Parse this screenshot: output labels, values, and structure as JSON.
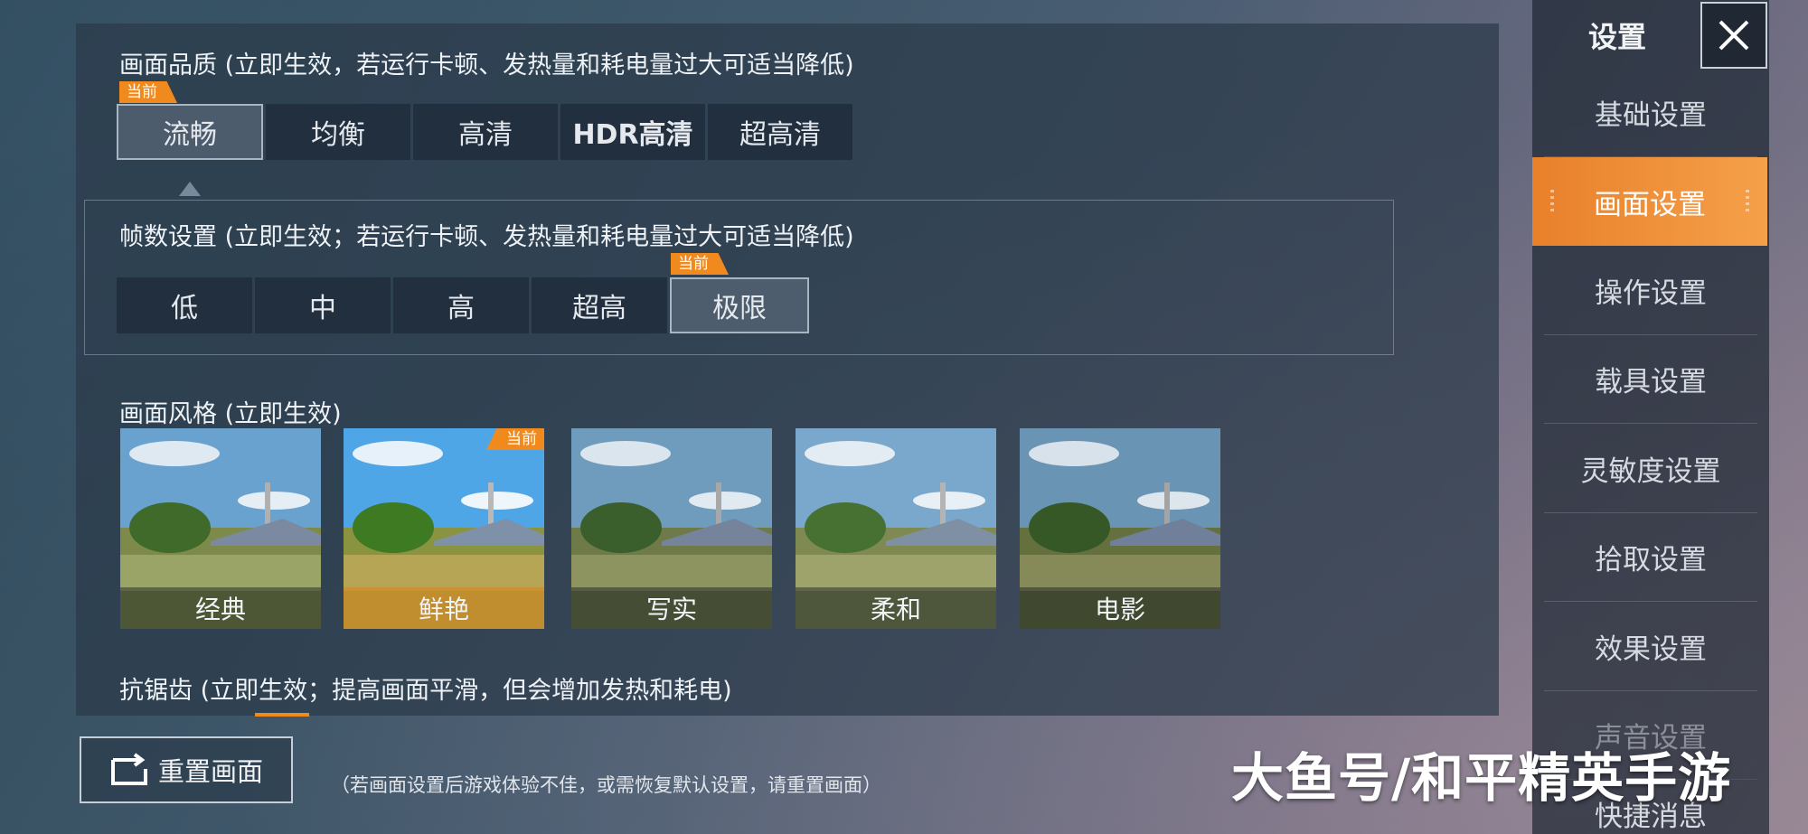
{
  "quality": {
    "title": "画面品质 (立即生效，若运行卡顿、发热量和耗电量过大可适当降低)",
    "current_badge": "当前",
    "options": [
      "流畅",
      "均衡",
      "高清",
      "HDR高清",
      "超高清"
    ],
    "selected": "流畅"
  },
  "fps": {
    "title": "帧数设置 (立即生效；若运行卡顿、发热量和耗电量过大可适当降低)",
    "current_badge": "当前",
    "options": [
      "低",
      "中",
      "高",
      "超高",
      "极限"
    ],
    "selected": "极限"
  },
  "style": {
    "title": "画面风格 (立即生效)",
    "current_badge": "当前",
    "options": [
      "经典",
      "鲜艳",
      "写实",
      "柔和",
      "电影"
    ],
    "selected": "鲜艳"
  },
  "antialias": {
    "title": "抗锯齿 (立即生效；提高画面平滑，但会增加发热和耗电)"
  },
  "sidebar": {
    "title": "设置",
    "items": [
      "基础设置",
      "画面设置",
      "操作设置",
      "载具设置",
      "灵敏度设置",
      "拾取设置",
      "效果设置",
      "声音设置",
      "快捷消息"
    ],
    "active": "画面设置"
  },
  "footer": {
    "reset_label": "重置画面",
    "hint": "（若画面设置后游戏体验不佳，或需恢复默认设置，请重置画面）"
  },
  "watermark": "大鱼号/和平精英手游",
  "icons": {
    "close": "close-icon",
    "reset": "reset-icon"
  },
  "colors": {
    "accent": "#f08a1e",
    "active_tab": "#ed8a34"
  }
}
